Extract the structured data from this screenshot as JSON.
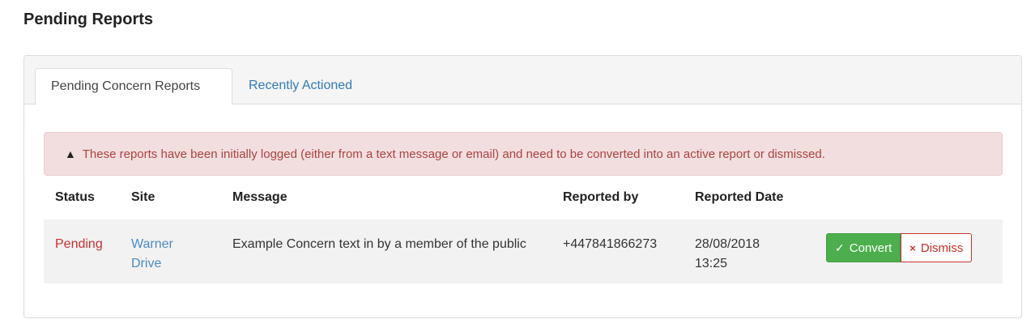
{
  "page": {
    "title": "Pending Reports"
  },
  "tabs": [
    {
      "label": "Pending Concern Reports",
      "active": true
    },
    {
      "label": "Recently Actioned",
      "active": false
    }
  ],
  "alert": {
    "icon": "warning-icon",
    "glyph": "▲",
    "text": "These reports have been initially logged (either from a text message or email) and need to be converted into an active report or dismissed."
  },
  "table": {
    "headers": [
      "Status",
      "Site",
      "Message",
      "Reported by",
      "Reported Date"
    ],
    "rows": [
      {
        "status": "Pending",
        "site": "Warner Drive",
        "message": "Example Concern text in by a member of the public",
        "reported_by": "+447841866273",
        "reported_date": "28/08/2018 13:25",
        "actions": {
          "convert_icon": "✓",
          "convert_label": "Convert",
          "dismiss_icon": "×",
          "dismiss_label": "Dismiss"
        }
      }
    ]
  },
  "colors": {
    "alert_bg": "#f2dede",
    "alert_text": "#a94442",
    "status_pending": "#c9302c",
    "link": "#337ab7",
    "convert_bg": "#4cae4c",
    "dismiss_border": "#c9302c"
  }
}
